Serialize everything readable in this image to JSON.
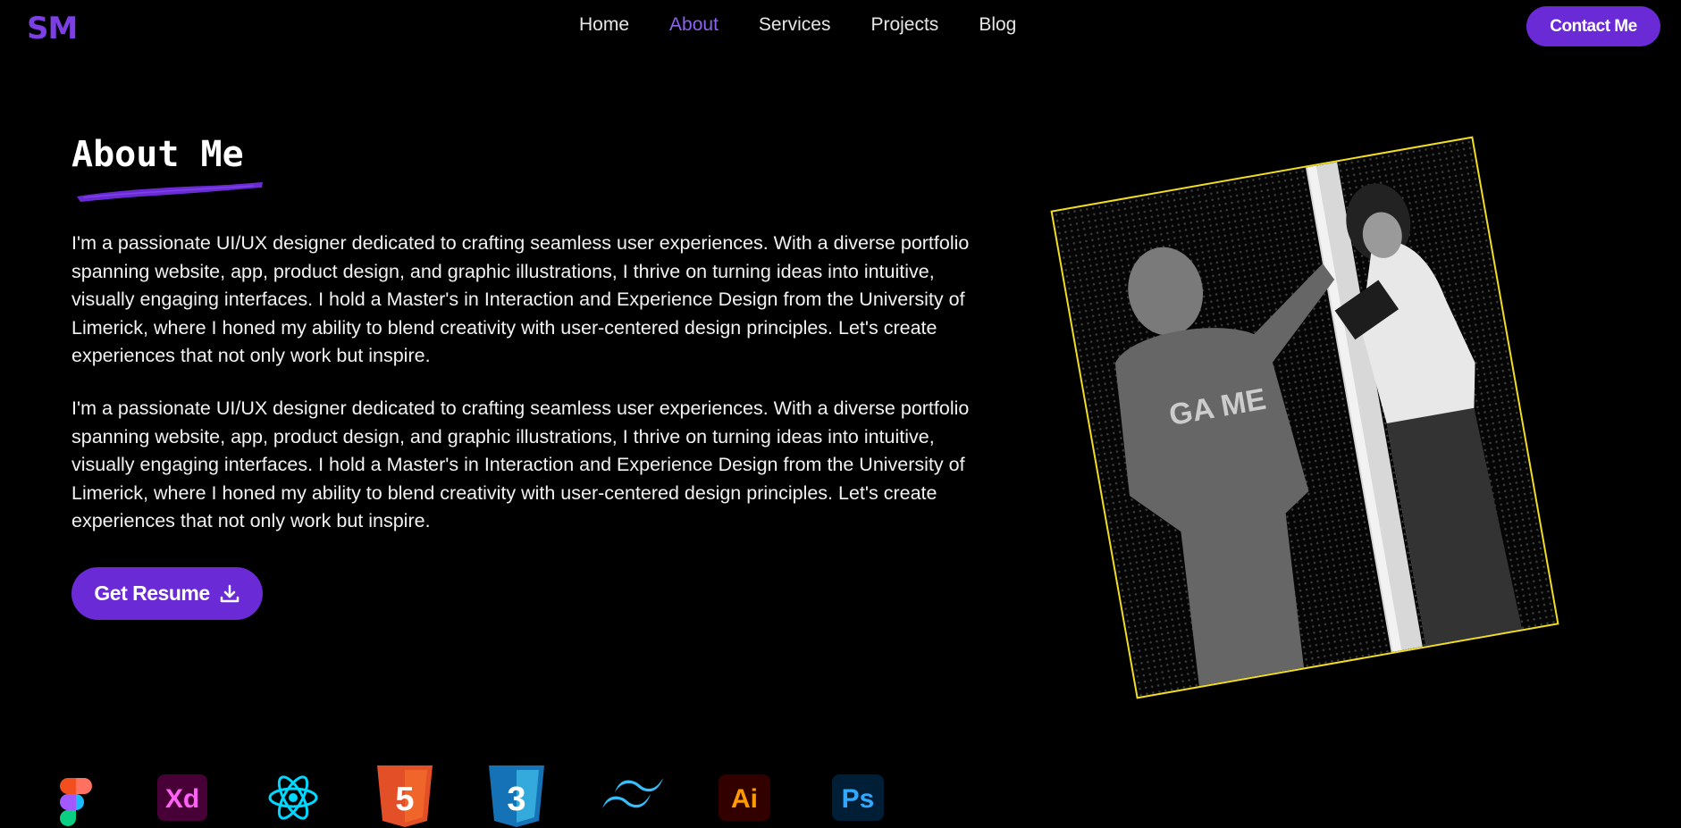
{
  "nav": {
    "logo": "SM",
    "links": [
      "Home",
      "About",
      "Services",
      "Projects",
      "Blog"
    ],
    "active_index": 1,
    "contact_label": "Contact Me"
  },
  "about": {
    "title": "About Me",
    "paragraphs": [
      "I'm a passionate UI/UX designer dedicated to crafting seamless user experiences. With a diverse portfolio spanning website, app, product design, and graphic illustrations, I thrive on turning ideas into intuitive, visually engaging interfaces. I hold a Master's in Interaction and Experience Design from the University of Limerick, where I honed my ability to blend creativity with user-centered design principles. Let's create experiences that not only work but inspire.",
      "I'm a passionate UI/UX designer dedicated to crafting seamless user experiences. With a diverse portfolio spanning website, app, product design, and graphic illustrations, I thrive on turning ideas into intuitive, visually engaging interfaces. I hold a Master's in Interaction and Experience Design from the University of Limerick, where I honed my ability to blend creativity with user-centered design principles. Let's create experiences that not only work but inspire."
    ],
    "resume_label": "Get Resume"
  },
  "tools": {
    "xd_label": "Xd",
    "ai_label": "Ai",
    "ps_label": "Ps",
    "html_label": "5",
    "css_label": "3"
  },
  "colors": {
    "accent": "#6a2bd6",
    "active_link": "#8d63f2",
    "frame": "#f0dd22"
  }
}
